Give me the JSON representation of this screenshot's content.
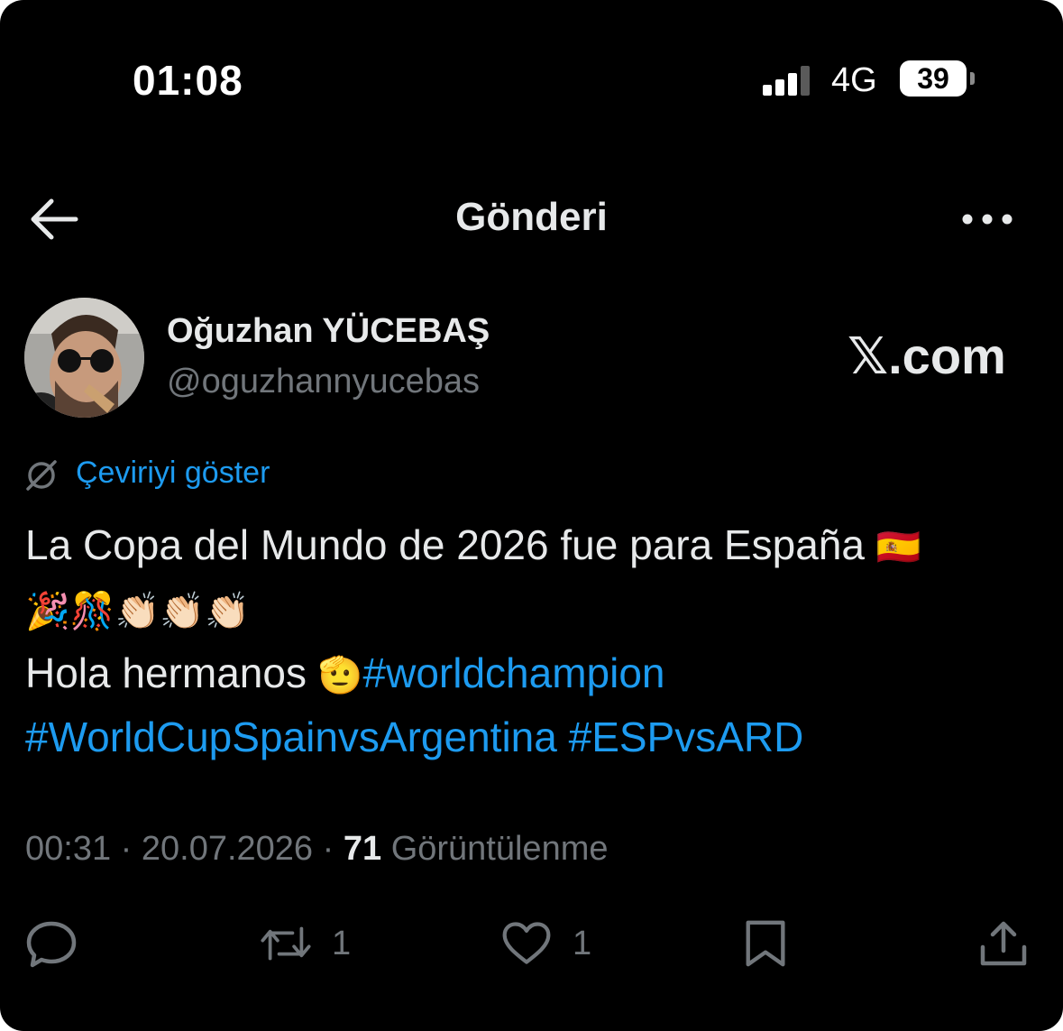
{
  "status_bar": {
    "time": "01:08",
    "network": "4G",
    "battery": "39"
  },
  "header": {
    "title": "Gönderi"
  },
  "author": {
    "display_name": "Oğuzhan YÜCEBAŞ",
    "handle": "@oguzhannyucebas",
    "watermark": "𝕏.com"
  },
  "translate": {
    "label": "Çeviriyi göster"
  },
  "tweet": {
    "line1_text": "La Copa del Mundo de 2026 fue para España",
    "line1_emoji": "🇪🇸",
    "line2_emoji": "🎉🎊👏🏻👏🏻👏🏻",
    "line3_text": "Hola hermanos",
    "line3_emoji": "🫡",
    "hashtag1": "#worldchampion",
    "hashtag2": "#WorldCupSpainvsArgentina",
    "hashtag3": "#ESPvsARD"
  },
  "meta": {
    "time": "00:31",
    "separator": "·",
    "date": "20.07.2026",
    "views_count": "71",
    "views_label": "Görüntülenme"
  },
  "actions": {
    "reply_icon": "reply-icon",
    "retweet_icon": "retweet-icon",
    "retweet_count": "1",
    "like_icon": "heart-icon",
    "like_count": "1",
    "bookmark_icon": "bookmark-icon",
    "share_icon": "share-icon"
  },
  "colors": {
    "background": "#000000",
    "text": "#e7e9ea",
    "muted": "#71767b",
    "accent": "#1d9bf0"
  }
}
